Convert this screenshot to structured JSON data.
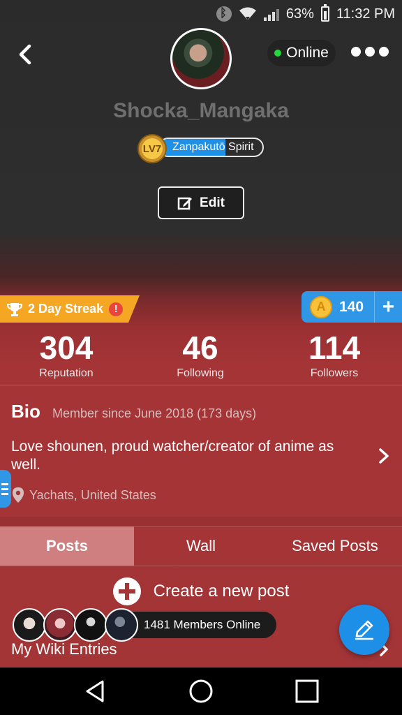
{
  "status_bar": {
    "battery": "63%",
    "time": "11:32 PM",
    "icons": [
      "bluetooth-icon",
      "wifi-icon",
      "signal-icon",
      "battery-icon"
    ]
  },
  "profile": {
    "username": "Shocka_Mangaka",
    "online_label": "Online",
    "level": "LV7",
    "title": "Zanpakutō Spirit",
    "title_progress": 0.64,
    "edit_label": "Edit"
  },
  "streak": {
    "label": "2 Day Streak",
    "alert": "!"
  },
  "coins": {
    "count": "140",
    "plus": "+"
  },
  "stats": [
    {
      "value": "304",
      "label": "Reputation"
    },
    {
      "value": "46",
      "label": "Following"
    },
    {
      "value": "114",
      "label": "Followers"
    }
  ],
  "bio": {
    "title": "Bio",
    "member_since": "Member since June 2018 (173 days)",
    "text": "Love shounen, proud watcher/creator of anime as well.",
    "location": "Yachats, United States"
  },
  "tabs": [
    {
      "label": "Posts",
      "active": true
    },
    {
      "label": "Wall",
      "active": false
    },
    {
      "label": "Saved Posts",
      "active": false
    }
  ],
  "create_post_label": "Create a new post",
  "members_online": "1481 Members Online",
  "wiki_label": "My Wiki Entries",
  "colors": {
    "accent": "#2f97e6",
    "profile_red": "#a33537",
    "streak": "#f5a623",
    "online": "#22d83a"
  }
}
